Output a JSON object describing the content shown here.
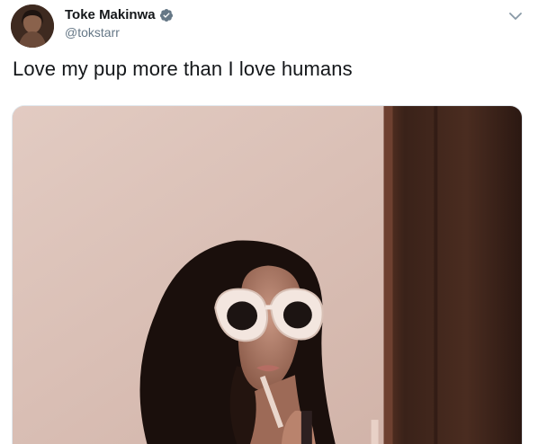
{
  "tweet": {
    "display_name": "Toke Makinwa",
    "handle": "@tokstarr",
    "text": "Love my pup more than I love humans",
    "verified": true
  },
  "icons": {
    "verified": "verified-badge-icon",
    "caret": "chevron-down-icon"
  },
  "colors": {
    "text": "#14171a",
    "secondary_text": "#657786",
    "verified_badge": "#657786",
    "wall": "#dcc2b8",
    "door": "#3a2219"
  }
}
